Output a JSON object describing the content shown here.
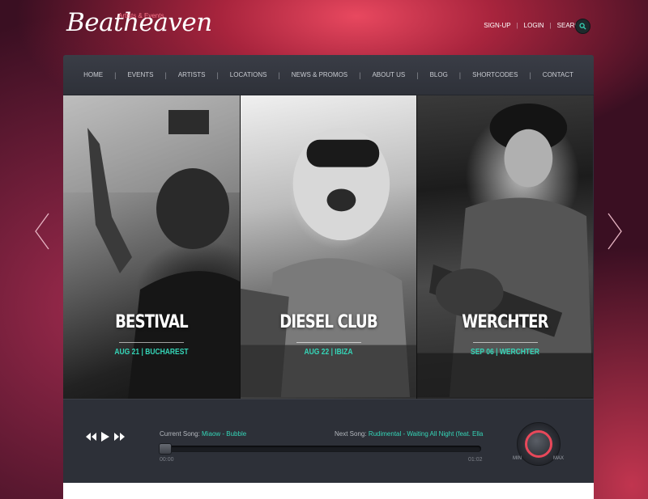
{
  "brand": {
    "name": "Beatheaven",
    "tagline": "Artists & Events"
  },
  "top_links": [
    "SIGN-UP",
    "LOGIN",
    "SEARCH"
  ],
  "icons": {
    "search": "search-icon",
    "prev": "chevron-left-icon",
    "next": "chevron-right-icon",
    "rewind": "rewind-icon",
    "play": "play-icon",
    "forward": "fast-forward-icon"
  },
  "nav": [
    "HOME",
    "EVENTS",
    "ARTISTS",
    "LOCATIONS",
    "NEWS & PROMOS",
    "ABOUT US",
    "BLOG",
    "SHORTCODES",
    "CONTACT"
  ],
  "slides": [
    {
      "title": "BESTIVAL",
      "date": "AUG 21 | BUCHAREST"
    },
    {
      "title": "DIESEL CLUB",
      "date": "AUG 22 | IBIZA"
    },
    {
      "title": "WERCHTER",
      "date": "SEP 06 | WERCHTER"
    }
  ],
  "player": {
    "current_label": "Current Song:",
    "current_value": "Miaow - Bubble",
    "next_label": "Next Song:",
    "next_value": "Rudimental - Waiting All Night (feat. Ella",
    "time_elapsed": "00:00",
    "time_total": "01:02",
    "progress": 0,
    "volume_min": "MIN",
    "volume_max": "MAX"
  },
  "colors": {
    "accent": "#35d6b8",
    "brand_pink": "#e8485a",
    "panel": "#2d3038"
  }
}
